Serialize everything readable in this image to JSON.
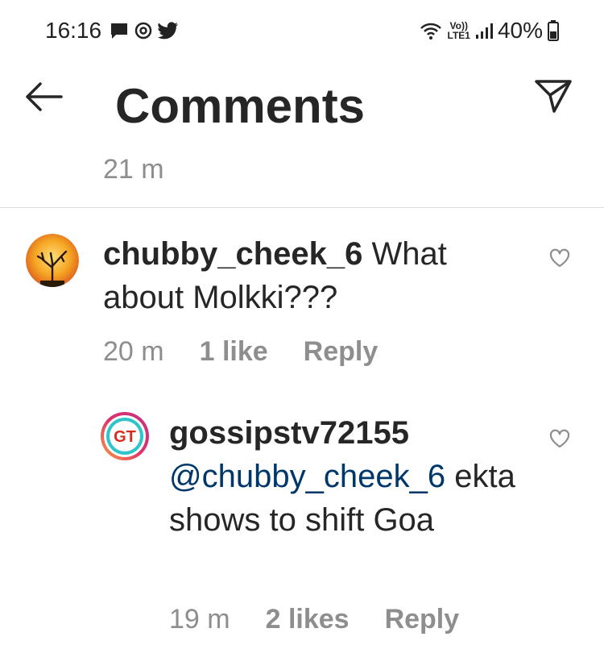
{
  "status_bar": {
    "time": "16:16",
    "volte_top": "Vo))",
    "volte_bottom": "LTE1",
    "battery": "40%"
  },
  "header": {
    "title": "Comments"
  },
  "caption": {
    "time": "21 m"
  },
  "comments": [
    {
      "username": "chubby_cheek_6",
      "text": "What about Molkki???",
      "time": "20 m",
      "likes": "1 like",
      "reply": "Reply"
    },
    {
      "username": "gossipstv72155",
      "mention": "@chubby_cheek_6",
      "text": "ekta shows to shift Goa",
      "time": "19 m",
      "likes": "2 likes",
      "reply": "Reply",
      "avatar_text": "GT"
    }
  ],
  "colors": {
    "text": "#262626",
    "secondary": "#8e8e8e",
    "mention": "#00376b",
    "divider": "#dbdbdb"
  }
}
